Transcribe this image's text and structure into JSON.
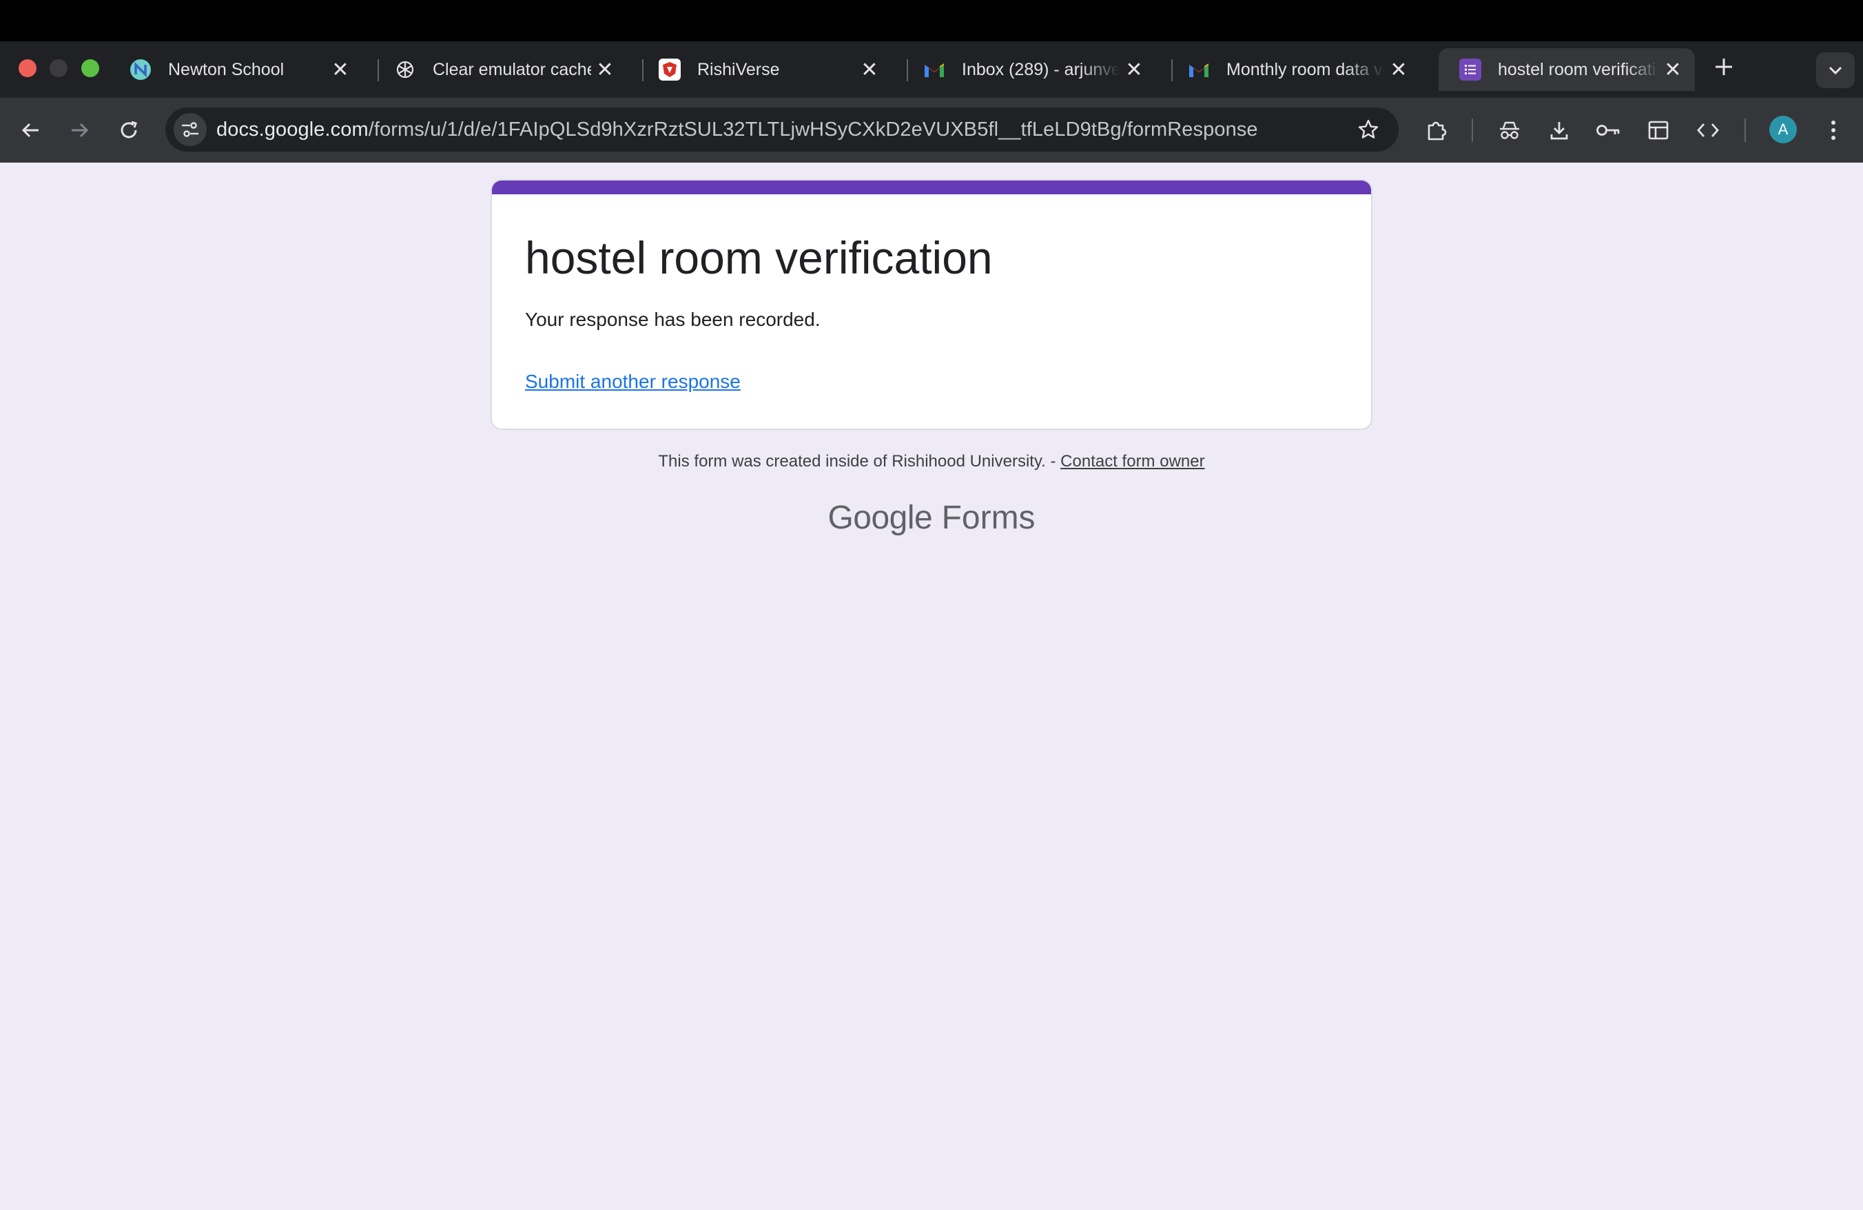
{
  "browser": {
    "tabs": [
      {
        "title": "Newton School",
        "icon": "newton-school-icon"
      },
      {
        "title": "Clear emulator cache",
        "icon": "chatgpt-icon"
      },
      {
        "title": "RishiVerse",
        "icon": "rishiverse-icon"
      },
      {
        "title": "Inbox (289) - arjunve",
        "icon": "gmail-icon"
      },
      {
        "title": "Monthly room data ve",
        "icon": "gmail-icon"
      },
      {
        "title": "hostel room verificati",
        "icon": "google-forms-icon",
        "active": true
      }
    ],
    "url": {
      "host": "docs.google.com",
      "path": "/forms/u/1/d/e/1FAIpQLSd9hXzrRztSUL32TLTLjwHSyCXkD2eVUXB5fl__tfLeLD9tBg/formResponse"
    },
    "profile_initial": "A"
  },
  "form": {
    "title": "hostel room verification",
    "confirmation": "Your response has been recorded.",
    "submit_another": "Submit another response",
    "accent_color": "#673ab7"
  },
  "footer": {
    "text": "This form was created inside of Rishihood University. - ",
    "contact_owner": "Contact form owner",
    "brand_google": "Google",
    "brand_forms": "Forms"
  }
}
